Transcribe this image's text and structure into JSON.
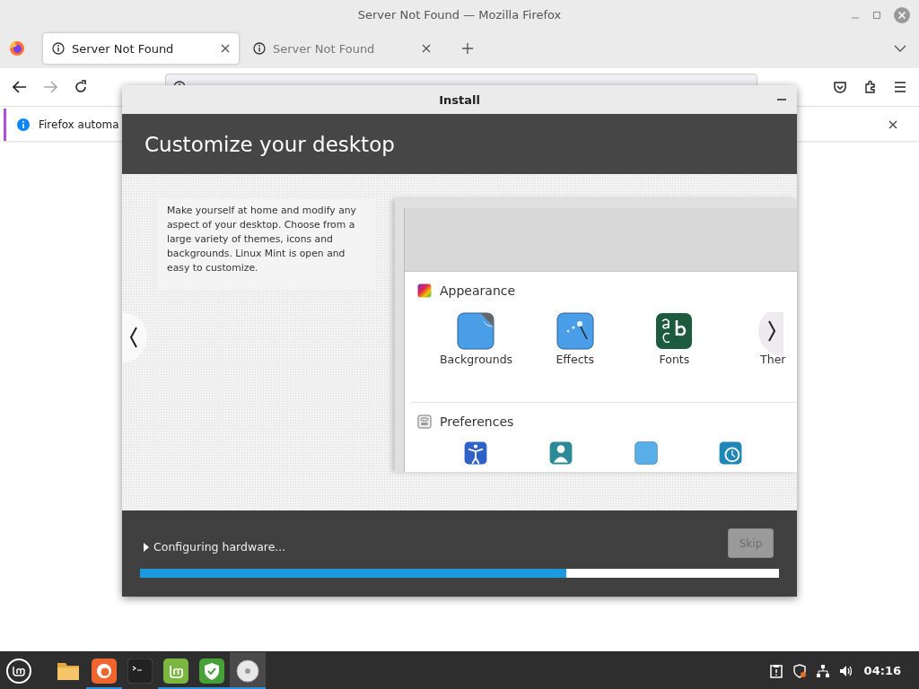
{
  "browser": {
    "title": "Server Not Found — Mozilla Firefox",
    "tabs": [
      {
        "label": "Server Not Found",
        "selected": true
      },
      {
        "label": "Server Not Found",
        "selected": false
      }
    ],
    "notification": "Firefox automa"
  },
  "installer": {
    "title": "Install",
    "heading": "Customize your desktop",
    "description": "Make yourself at home and modify any aspect of your desktop. Choose from a large variety of themes, icons and backgrounds. Linux Mint is open and easy to customize.",
    "preview": {
      "sections": [
        {
          "kind": "appearance",
          "title": "Appearance",
          "items": [
            {
              "kind": "backgrounds",
              "label": "Backgrounds"
            },
            {
              "kind": "effects",
              "label": "Effects"
            },
            {
              "kind": "fonts",
              "label": "Fonts"
            },
            {
              "kind": "themes",
              "label": "Ther"
            }
          ]
        },
        {
          "kind": "preferences",
          "title": "Preferences",
          "items": [
            {
              "kind": "accessibility"
            },
            {
              "kind": "account"
            },
            {
              "kind": "blank"
            },
            {
              "kind": "clock"
            }
          ]
        }
      ]
    },
    "status": "Configuring hardware...",
    "skip": {
      "label": "Skip",
      "disabled": true
    },
    "progress": {
      "level": 0.667
    }
  },
  "taskbar": {
    "apps": [
      {
        "kind": "files",
        "running": false,
        "selected": false
      },
      {
        "kind": "firefox",
        "running": true,
        "selected": false
      },
      {
        "kind": "terminal",
        "running": false,
        "selected": false
      },
      {
        "kind": "mint",
        "running": true,
        "selected": false
      },
      {
        "kind": "shield",
        "running": true,
        "selected": false
      },
      {
        "kind": "disc",
        "running": true,
        "selected": true
      }
    ],
    "clock": "04:16"
  }
}
